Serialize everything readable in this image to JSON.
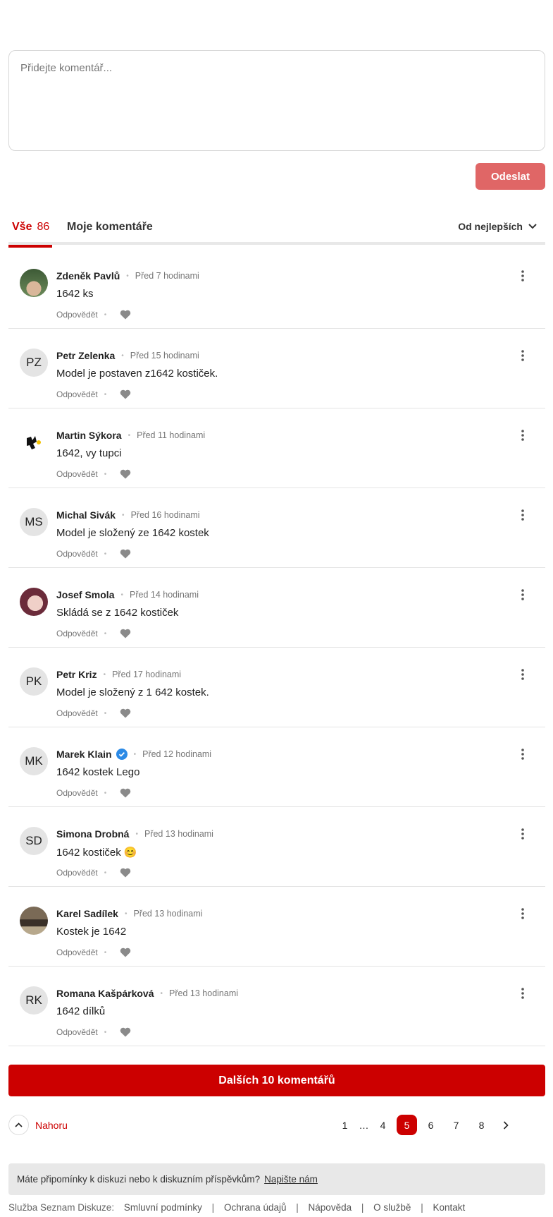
{
  "composer": {
    "placeholder": "Přidejte komentář...",
    "send_label": "Odeslat"
  },
  "tabs": {
    "all_label": "Vše",
    "all_count": "86",
    "mine_label": "Moje komentáře",
    "sort_label": "Od nejlepších"
  },
  "comments": [
    {
      "author": "Zdeněk Pavlů",
      "time": "Před 7 hodinami",
      "text": "1642 ks",
      "initials": "",
      "avatar": "photo-green",
      "verified": false
    },
    {
      "author": "Petr Zelenka",
      "time": "Před 15 hodinami",
      "text": "Model je postaven z1642 kostiček.",
      "initials": "PZ",
      "avatar": "initials",
      "verified": false
    },
    {
      "author": "Martin Sýkora",
      "time": "Před 11 hodinami",
      "text": "1642, vy tupci",
      "initials": "",
      "avatar": "photo-logo",
      "verified": false
    },
    {
      "author": "Michal Sivák",
      "time": "Před 16 hodinami",
      "text": "Model je složený ze 1642 kostek",
      "initials": "MS",
      "avatar": "initials",
      "verified": false
    },
    {
      "author": "Josef Smola",
      "time": "Před 14 hodinami",
      "text": "Skládá se z 1642 kostiček",
      "initials": "",
      "avatar": "photo-baby",
      "verified": false
    },
    {
      "author": "Petr Kriz",
      "time": "Před 17 hodinami",
      "text": "Model je složený z 1 642 kostek.",
      "initials": "PK",
      "avatar": "initials",
      "verified": false
    },
    {
      "author": "Marek Klain",
      "time": "Před 12 hodinami",
      "text": "1642 kostek Lego",
      "initials": "MK",
      "avatar": "initials",
      "verified": true
    },
    {
      "author": "Simona Drobná",
      "time": "Před 13 hodinami",
      "text": "1642 kostiček 😊",
      "initials": "SD",
      "avatar": "initials",
      "verified": false
    },
    {
      "author": "Karel Sadílek",
      "time": "Před 13 hodinami",
      "text": "Kostek je 1642",
      "initials": "",
      "avatar": "photo-car",
      "verified": false
    },
    {
      "author": "Romana Kašpárková",
      "time": "Před 13 hodinami",
      "text": "1642 dílků",
      "initials": "RK",
      "avatar": "initials",
      "verified": false
    }
  ],
  "comment_actions": {
    "reply_label": "Odpovědět"
  },
  "more_button": "Dalších 10 komentářů",
  "back_to_top": "Nahoru",
  "pagination": {
    "pages": [
      "1",
      "…",
      "4",
      "5",
      "6",
      "7",
      "8"
    ],
    "current": "5"
  },
  "feedback": {
    "text": "Máte připomínky k diskuzi nebo k diskuzním příspěvkům?",
    "link": "Napište nám"
  },
  "footer": {
    "label": "Služba Seznam Diskuze:",
    "links": [
      "Smluvní podmínky",
      "Ochrana údajů",
      "Nápověda",
      "O službě",
      "Kontakt"
    ]
  },
  "colors": {
    "accent": "#cc0000",
    "send_disabled": "#e06666",
    "verified": "#2b8ae6"
  }
}
